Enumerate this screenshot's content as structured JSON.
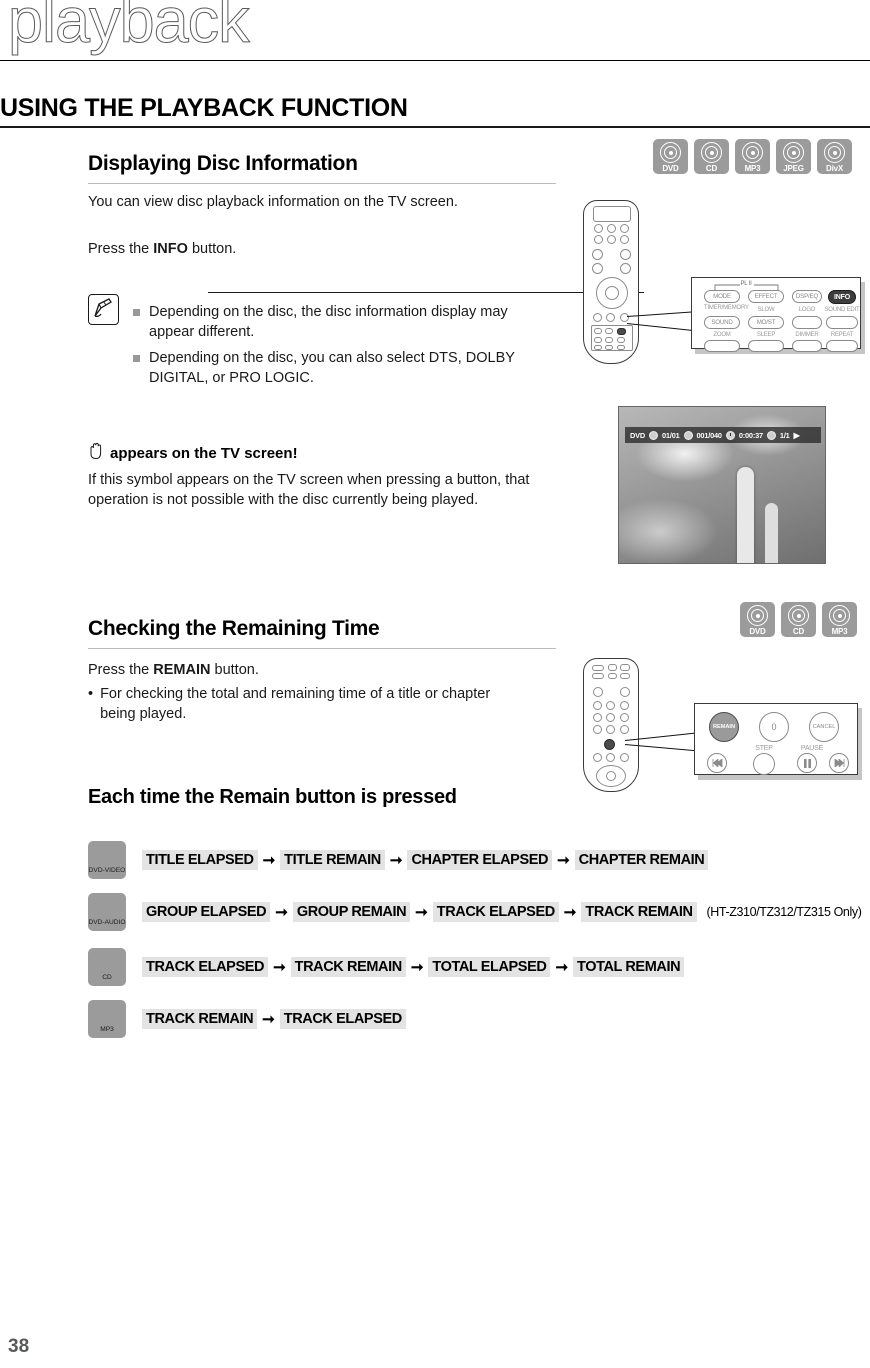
{
  "chapter": {
    "title": "playback"
  },
  "section": {
    "title": "USING THE PLAYBACK FUNCTION"
  },
  "disc_badges_top": [
    {
      "label": "DVD",
      "icon": "disc-icon"
    },
    {
      "label": "CD",
      "icon": "disc-icon"
    },
    {
      "label": "MP3",
      "icon": "disc-icon"
    },
    {
      "label": "JPEG",
      "icon": "disc-icon"
    },
    {
      "label": "DivX",
      "icon": "disc-icon"
    }
  ],
  "disc_badges_remaining": [
    {
      "label": "DVD",
      "icon": "disc-icon"
    },
    {
      "label": "CD",
      "icon": "disc-icon"
    },
    {
      "label": "MP3",
      "icon": "disc-icon"
    }
  ],
  "displaying_disc_information": {
    "heading": "Displaying Disc Information",
    "intro": "You can view disc playback information  on the TV screen.",
    "instruction_prefix": "Press the ",
    "instruction_button": "INFO",
    "instruction_suffix": " button.",
    "notes": [
      "Depending on the disc, the disc information display may appear different.",
      "Depending on the disc, you can also select DTS, DOLBY DIGITAL, or PRO LOGIC."
    ]
  },
  "hand_symbol": {
    "heading": "appears on the TV screen!",
    "body": "If this symbol appears on the TV screen when pressing a button, that operation is not possible with the disc currently being played."
  },
  "tv_osd": {
    "disc_type": "DVD",
    "title_index": "01/01",
    "chapter_index": "001/040",
    "elapsed_time": "0:00:37",
    "audio_index": "1/1",
    "play_glyph": "▶"
  },
  "remote_callout_info": {
    "surround_label": "PL II",
    "buttons": [
      {
        "label": "MODE",
        "highlighted": false
      },
      {
        "label": "EFFECT",
        "highlighted": false
      },
      {
        "label": "DSP/EQ",
        "highlighted": false
      },
      {
        "label": "INFO",
        "highlighted": true
      },
      {
        "label": "SOUND",
        "highlighted": false
      },
      {
        "label": "MO/ST",
        "highlighted": false
      }
    ],
    "top_labels": [
      "TIMER/MEMORY",
      "SLOW",
      "LOGO",
      "SOUND EDIT"
    ],
    "bottom_labels": [
      "ZOOM",
      "SLEEP",
      "DIMMER",
      "REPEAT"
    ]
  },
  "remote_callout_remain": {
    "buttons": [
      {
        "label": "REMAIN",
        "highlighted": true
      },
      {
        "label": "0",
        "highlighted": false
      },
      {
        "label": "CANCEL",
        "highlighted": false
      }
    ],
    "labels": [
      "STEP",
      "PAUSE"
    ],
    "transport": [
      "skip-back-icon",
      "step-icon",
      "pause-icon",
      "skip-forward-icon"
    ]
  },
  "checking_remaining_time": {
    "heading": "Checking the Remaining Time",
    "instruction_prefix": "Press the ",
    "instruction_button": "REMAIN",
    "instruction_suffix": " button.",
    "bullet": "For checking the total and remaining time of a title or chapter being played."
  },
  "remain_sequence": {
    "heading": "Each time the Remain button is pressed",
    "arrow": "➞",
    "rows": [
      {
        "badge": "DVD-VIDEO",
        "steps": [
          "TITLE ELAPSED",
          "TITLE REMAIN",
          "CHAPTER ELAPSED",
          "CHAPTER REMAIN"
        ],
        "note": ""
      },
      {
        "badge": "DVD-AUDIO",
        "steps": [
          "GROUP ELAPSED",
          "GROUP REMAIN",
          "TRACK ELAPSED",
          "TRACK REMAIN"
        ],
        "note": "(HT-Z310/TZ312/TZ315 Only)"
      },
      {
        "badge": "CD",
        "steps": [
          "TRACK ELAPSED",
          "TRACK REMAIN",
          "TOTAL ELAPSED",
          "TOTAL REMAIN"
        ],
        "note": ""
      },
      {
        "badge": "MP3",
        "steps": [
          "TRACK REMAIN",
          "TRACK ELAPSED"
        ],
        "note": ""
      }
    ]
  },
  "footer": {
    "page_number": "38"
  },
  "colors": {
    "badge_gray": "#9b9b9b",
    "highlight_gray": "#e3e3e3",
    "rule_dark": "#1a1a1a",
    "page_number": "#58595b"
  }
}
